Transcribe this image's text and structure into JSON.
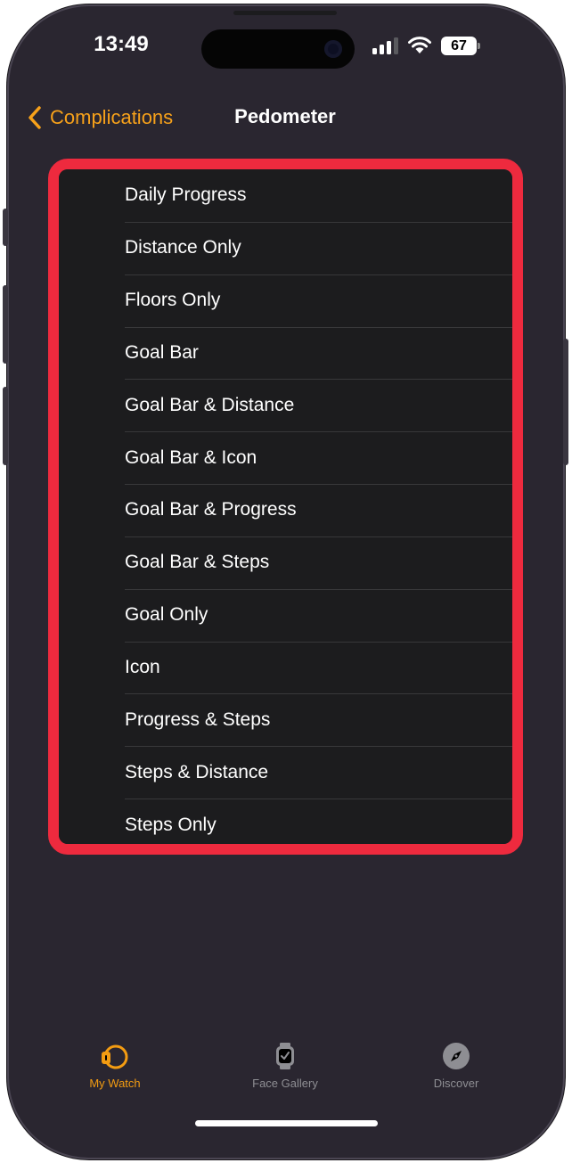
{
  "status_bar": {
    "time": "13:49",
    "battery": "67"
  },
  "nav": {
    "back_label": "Complications",
    "title": "Pedometer",
    "accent_color": "#F7A11A"
  },
  "options": [
    "Daily Progress",
    "Distance Only",
    "Floors Only",
    "Goal Bar",
    "Goal Bar & Distance",
    "Goal Bar & Icon",
    "Goal Bar & Progress",
    "Goal Bar & Steps",
    "Goal Only",
    "Icon",
    "Progress & Steps",
    "Steps & Distance",
    "Steps Only"
  ],
  "highlight_color": "#EE2A3E",
  "tab_bar": {
    "tabs": [
      {
        "label": "My Watch",
        "icon": "watch-icon",
        "selected": true
      },
      {
        "label": "Face Gallery",
        "icon": "watch-face-icon",
        "selected": false
      },
      {
        "label": "Discover",
        "icon": "compass-icon",
        "selected": false
      }
    ]
  }
}
